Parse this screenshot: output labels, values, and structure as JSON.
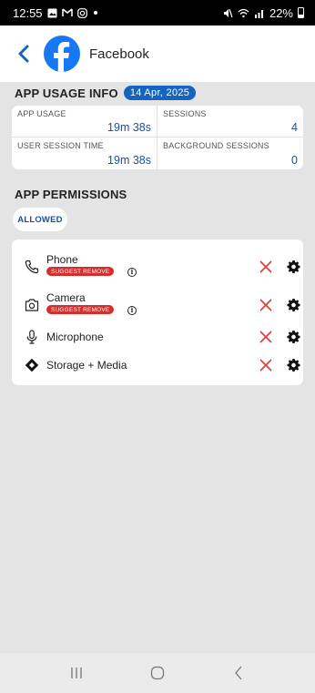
{
  "status_bar": {
    "time": "12:55",
    "battery": "22%"
  },
  "header": {
    "title": "Facebook",
    "app_icon": "facebook-logo-icon",
    "brand_color": "#1877f2"
  },
  "usage_info": {
    "title": "APP USAGE INFO",
    "date": "14 Apr, 2025",
    "cells": [
      {
        "label": "APP USAGE",
        "value": "19m 38s"
      },
      {
        "label": "SESSIONS",
        "value": "4"
      },
      {
        "label": "USER SESSION TIME",
        "value": "19m 38s"
      },
      {
        "label": "BACKGROUND SESSIONS",
        "value": "0"
      }
    ]
  },
  "permissions": {
    "title": "APP PERMISSIONS",
    "filter_label": "ALLOWED",
    "items": [
      {
        "name": "Phone",
        "icon": "phone-icon",
        "badge": "SUGGEST REMOVE"
      },
      {
        "name": "Camera",
        "icon": "camera-icon",
        "badge": "SUGGEST REMOVE"
      },
      {
        "name": "Microphone",
        "icon": "microphone-icon",
        "badge": ""
      },
      {
        "name": "Storage + Media",
        "icon": "storage-icon",
        "badge": ""
      }
    ]
  },
  "colors": {
    "accent": "#1565c0",
    "danger": "#d32f2f",
    "value_text": "#1a4fa0"
  }
}
